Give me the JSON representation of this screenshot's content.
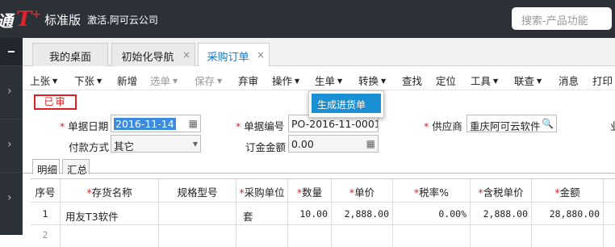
{
  "header": {
    "logo_left": "通",
    "logo_t": "T",
    "logo_plus": "+",
    "edition": "标准版",
    "company": "激活.阿可云公司",
    "search_placeholder": "搜索-产品功能"
  },
  "tabs": [
    {
      "label": "我的桌面"
    },
    {
      "label": "初始化导航",
      "close": "×"
    },
    {
      "label": "采购订单",
      "close": "×"
    }
  ],
  "toolbar": {
    "prev": "上张",
    "next": "下张",
    "add": "新增",
    "select": "选单",
    "save": "保存",
    "unapprove": "弃审",
    "operate": "操作",
    "generate": "生单",
    "convert": "转换",
    "find": "查找",
    "locate": "定位",
    "tools": "工具",
    "linked": "联查",
    "message": "消息",
    "print": "打印"
  },
  "dropdown": {
    "item": "生成进货单"
  },
  "form": {
    "status": "已审",
    "date_label": "单据日期",
    "date_value": "2016-11-14",
    "number_label": "单据编号",
    "number_value": "PO-2016-11-0001",
    "supplier_label": "供应商",
    "supplier_value": "重庆阿可云软件",
    "payment_label": "付款方式",
    "payment_value": "其它",
    "deposit_label": "订金金额",
    "deposit_value": "0.00",
    "cut_label": "业"
  },
  "grid_tabs": [
    "明细",
    "汇总"
  ],
  "table": {
    "headers": [
      "序号",
      "存货名称",
      "规格型号",
      "采购单位",
      "数量",
      "单价",
      "税率%",
      "含税单价",
      "金额"
    ],
    "rows": [
      [
        "1",
        "用友T3软件",
        "",
        "套",
        "10.00",
        "2,888.00",
        "0.00%",
        "2,888.00",
        "28,880.00"
      ],
      [
        "2",
        "",
        "",
        "",
        "",
        "",
        "",
        "",
        ""
      ]
    ]
  }
}
